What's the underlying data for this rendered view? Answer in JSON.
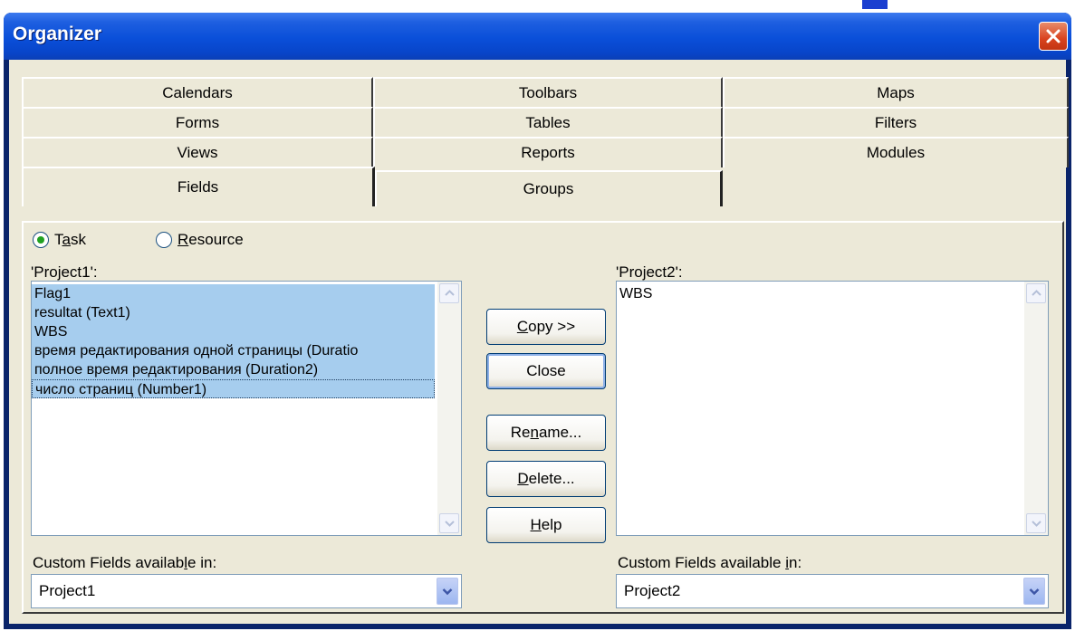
{
  "window": {
    "title": "Organizer"
  },
  "tabs": {
    "row1": [
      "Calendars",
      "Toolbars",
      "Maps"
    ],
    "row2": [
      "Forms",
      "Tables",
      "Filters"
    ],
    "row3": [
      "Views",
      "Reports",
      "Modules"
    ],
    "row4": [
      "Fields",
      "Groups"
    ],
    "active": "Fields"
  },
  "radios": {
    "task": {
      "label": "Task",
      "checked": true
    },
    "resource": {
      "label": "Resource",
      "checked": false
    }
  },
  "left_list": {
    "label": "'Project1':",
    "items": [
      "Flag1",
      "resultat (Text1)",
      "WBS",
      "время редактирования одной страницы (Duratio",
      "полное время редактирования (Duration2)",
      "число страниц (Number1)"
    ]
  },
  "right_list": {
    "label": "'Project2':",
    "items": [
      "WBS"
    ]
  },
  "buttons": {
    "copy": "Copy >>",
    "close": "Close",
    "rename": "Rename...",
    "delete": "Delete...",
    "help": "Help"
  },
  "left_combo": {
    "label": "Custom Fields available in:",
    "value": "Project1"
  },
  "right_combo": {
    "label": "Custom Fields available in:",
    "value": "Project2"
  },
  "colors": {
    "title_bar": "#0a4fd9",
    "selection": "#a6cdee",
    "dialog_bg": "#ece9d8"
  }
}
